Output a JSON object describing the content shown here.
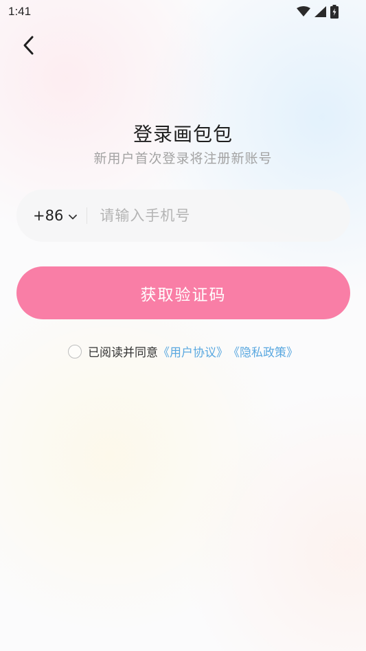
{
  "status_bar": {
    "time": "1:41",
    "icons": [
      "wifi-icon",
      "signal-icon",
      "battery-charging-icon"
    ]
  },
  "header": {
    "back_icon": "chevron-left-icon"
  },
  "login": {
    "title": "登录画包包",
    "subtitle": "新用户首次登录将注册新账号",
    "country_code": "+86",
    "phone_placeholder": "请输入手机号",
    "phone_value": "",
    "get_code_label": "获取验证码"
  },
  "agreement": {
    "checked": false,
    "text": "已阅读并同意",
    "user_agreement": "《用户协议》",
    "privacy_policy": "《隐私政策》"
  },
  "colors": {
    "primary_button": "#f97ea6",
    "link": "#5aa8e0",
    "title": "#1f1f1f",
    "subtitle": "#a3a3a3"
  }
}
